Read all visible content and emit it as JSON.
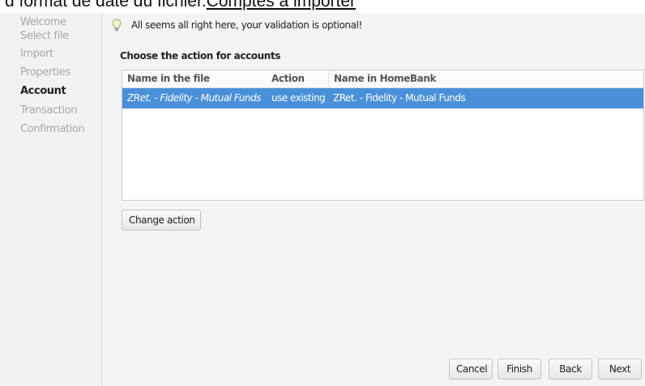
{
  "header_fragment": {
    "text_before": "d format de date du fichier.",
    "link": "Comptes à importer"
  },
  "sidebar": {
    "steps": [
      {
        "label": "Welcome",
        "active": false
      },
      {
        "label": "Select file",
        "active": false
      },
      {
        "label": "Import",
        "active": false
      },
      {
        "label": "Properties",
        "active": false
      },
      {
        "label": "Account",
        "active": true
      },
      {
        "label": "Transaction",
        "active": false
      },
      {
        "label": "Confirmation",
        "active": false
      }
    ]
  },
  "main": {
    "info_icon": "lightbulb-icon",
    "info_text": "All seems all right here, your validation is optional!",
    "section_title": "Choose the action for accounts",
    "table": {
      "columns": [
        "Name in the file",
        "Action",
        "Name in HomeBank"
      ],
      "rows": [
        {
          "file_name": "ZRet. - Fidelity - Mutual Funds",
          "action": "use existing",
          "homebank_name": "ZRet. - Fidelity - Mutual Funds",
          "selected": true
        }
      ]
    },
    "change_action_label": "Change action"
  },
  "footer": {
    "cancel_label": "Cancel",
    "finish_label": "Finish",
    "back_label": "Back",
    "next_label": "Next"
  },
  "colors": {
    "selection": "#4a90d9",
    "sidebar_bg": "#f2f2f2",
    "window_bg": "#f4f4f4"
  }
}
